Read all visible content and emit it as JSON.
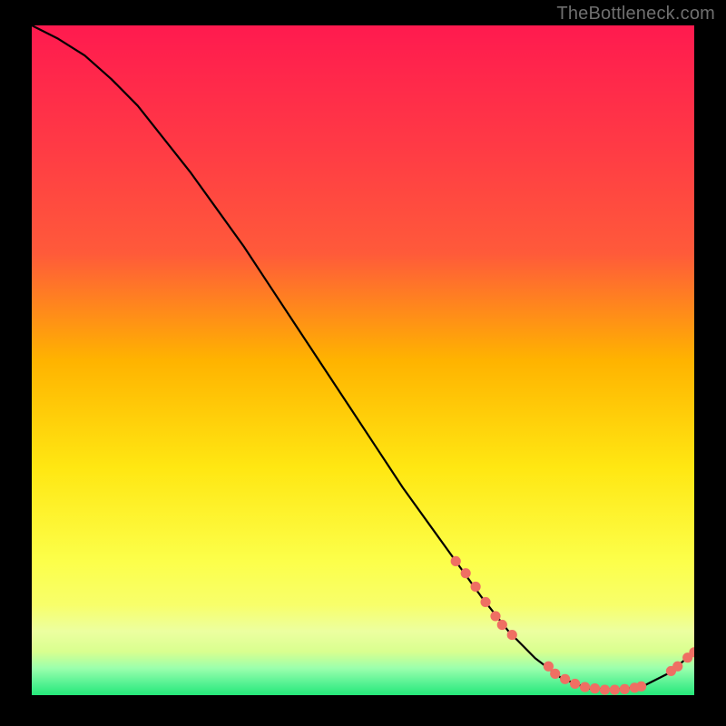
{
  "watermark": "TheBottleneck.com",
  "colors": {
    "bg_black": "#000000",
    "grad_top": "#ff1a4f",
    "grad_mid1": "#ff5a3a",
    "grad_mid2": "#ffb300",
    "grad_mid3": "#ffe712",
    "grad_low1": "#f8ff6a",
    "grad_low2": "#d9ff8f",
    "grad_low3": "#9affad",
    "grad_bottom": "#25e879",
    "line": "#000000",
    "dot": "#ef6f63"
  },
  "chart_data": {
    "type": "line",
    "title": "",
    "xlabel": "",
    "ylabel": "",
    "xlim": [
      0,
      100
    ],
    "ylim": [
      0,
      100
    ],
    "series": [
      {
        "name": "curve",
        "x": [
          0,
          4,
          8,
          12,
          16,
          20,
          24,
          28,
          32,
          36,
          40,
          44,
          48,
          52,
          56,
          60,
          64,
          68,
          72,
          76,
          80,
          84,
          88,
          92,
          96,
          100
        ],
        "y": [
          100,
          98,
          95.5,
          92,
          88,
          83,
          78,
          72.5,
          67,
          61,
          55,
          49,
          43,
          37,
          31,
          25.5,
          20,
          14.5,
          9.5,
          5.5,
          2.5,
          1,
          0.8,
          1.2,
          3.2,
          6.4
        ]
      }
    ],
    "dots": {
      "name": "markers",
      "points": [
        {
          "x": 64.0,
          "y": 20.0
        },
        {
          "x": 65.5,
          "y": 18.2
        },
        {
          "x": 67.0,
          "y": 16.2
        },
        {
          "x": 68.5,
          "y": 13.9
        },
        {
          "x": 70.0,
          "y": 11.8
        },
        {
          "x": 71.0,
          "y": 10.5
        },
        {
          "x": 72.5,
          "y": 9.0
        },
        {
          "x": 78.0,
          "y": 4.3
        },
        {
          "x": 79.0,
          "y": 3.2
        },
        {
          "x": 80.5,
          "y": 2.4
        },
        {
          "x": 82.0,
          "y": 1.7
        },
        {
          "x": 83.5,
          "y": 1.2
        },
        {
          "x": 85.0,
          "y": 1.0
        },
        {
          "x": 86.5,
          "y": 0.8
        },
        {
          "x": 88.0,
          "y": 0.8
        },
        {
          "x": 89.5,
          "y": 0.9
        },
        {
          "x": 91.0,
          "y": 1.1
        },
        {
          "x": 92.0,
          "y": 1.3
        },
        {
          "x": 96.5,
          "y": 3.6
        },
        {
          "x": 97.5,
          "y": 4.3
        },
        {
          "x": 99.0,
          "y": 5.6
        },
        {
          "x": 100.0,
          "y": 6.4
        }
      ]
    }
  }
}
